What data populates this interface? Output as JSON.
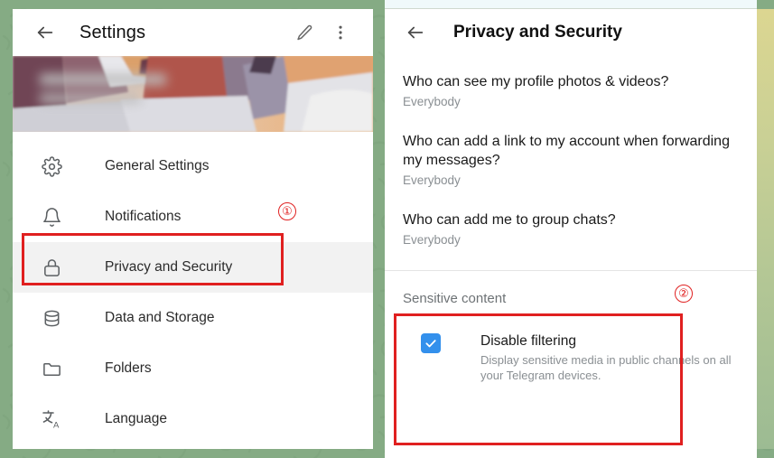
{
  "theme": {
    "background_green": "#85ab84",
    "panel_white": "#ffffff",
    "accent_blue": "#3390ec",
    "annotation_red": "#e02020",
    "active_row_grey": "#f2f2f2",
    "secondary_text": "#8a8f93"
  },
  "settings_panel": {
    "back_icon": "arrow-left-icon",
    "title": "Settings",
    "edit_icon": "pencil-icon",
    "more_icon": "more-vertical-icon",
    "banner": {
      "type": "profile-cover-photo",
      "name_overlay": "blurred"
    },
    "menu": [
      {
        "icon": "gear-icon",
        "label": "General Settings",
        "active": false
      },
      {
        "icon": "bell-icon",
        "label": "Notifications",
        "active": false
      },
      {
        "icon": "lock-icon",
        "label": "Privacy and Security",
        "active": true
      },
      {
        "icon": "database-icon",
        "label": "Data and Storage",
        "active": false
      },
      {
        "icon": "folder-icon",
        "label": "Folders",
        "active": false
      },
      {
        "icon": "translate-icon",
        "label": "Language",
        "active": false
      }
    ]
  },
  "privacy_panel": {
    "back_icon": "arrow-left-icon",
    "title": "Privacy and Security",
    "items": [
      {
        "question": "Who can see my profile photos & videos?",
        "value": "Everybody"
      },
      {
        "question": "Who can add a link to my account when forwarding my messages?",
        "value": "Everybody"
      },
      {
        "question": "Who can add me to group chats?",
        "value": "Everybody"
      }
    ],
    "sensitive_content": {
      "section_title": "Sensitive content",
      "checkbox_checked": true,
      "checkbox_icon": "checkmark-icon",
      "option_title": "Disable filtering",
      "option_description": "Display sensitive media in public channels on all your Telegram devices."
    }
  },
  "annotations": {
    "marker_1": "①",
    "marker_2": "②"
  }
}
